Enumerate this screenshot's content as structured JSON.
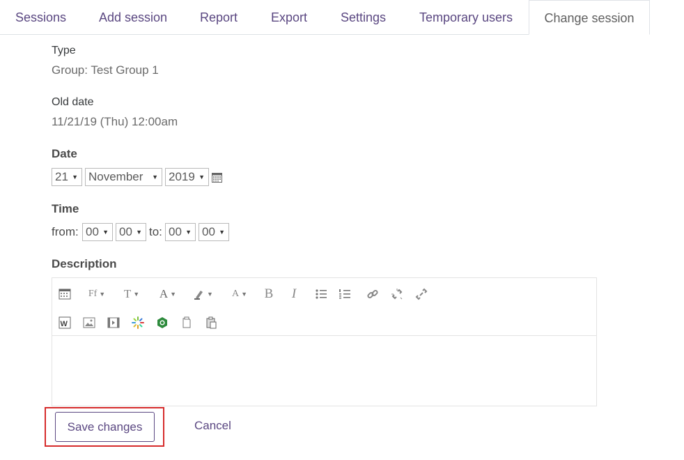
{
  "tabs": [
    {
      "label": "Sessions"
    },
    {
      "label": "Add session"
    },
    {
      "label": "Report"
    },
    {
      "label": "Export"
    },
    {
      "label": "Settings"
    },
    {
      "label": "Temporary users"
    },
    {
      "label": "Change session",
      "active": true
    }
  ],
  "type": {
    "label": "Type",
    "value": "Group: Test Group 1"
  },
  "old_date": {
    "label": "Old date",
    "value": "11/21/19 (Thu) 12:00am"
  },
  "date": {
    "label": "Date",
    "day": "21",
    "month": "November",
    "year": "2019",
    "calendar_icon": "calendar-icon"
  },
  "time": {
    "label": "Time",
    "from_label": "from:",
    "from_hour": "00",
    "from_minute": "00",
    "to_label": "to:",
    "to_hour": "00",
    "to_minute": "00"
  },
  "description": {
    "label": "Description",
    "toolbar_row1": [
      "toolbar-toggle-icon",
      "font-family-icon",
      "font-size-icon",
      "font-color-icon",
      "highlight-color-icon",
      "text-style-icon",
      "bold-icon",
      "italic-icon",
      "unordered-list-icon",
      "ordered-list-icon",
      "link-icon",
      "unlink-icon",
      "anchor-link-icon"
    ],
    "toolbar_row2": [
      "paste-word-icon",
      "insert-image-icon",
      "insert-media-icon",
      "loading-icon",
      "recycle-icon",
      "copy-icon",
      "paste-icon"
    ],
    "content": ""
  },
  "buttons": {
    "save": "Save changes",
    "cancel": "Cancel"
  },
  "colors": {
    "accent": "#5a4781",
    "highlight_border": "#d62b2b"
  }
}
